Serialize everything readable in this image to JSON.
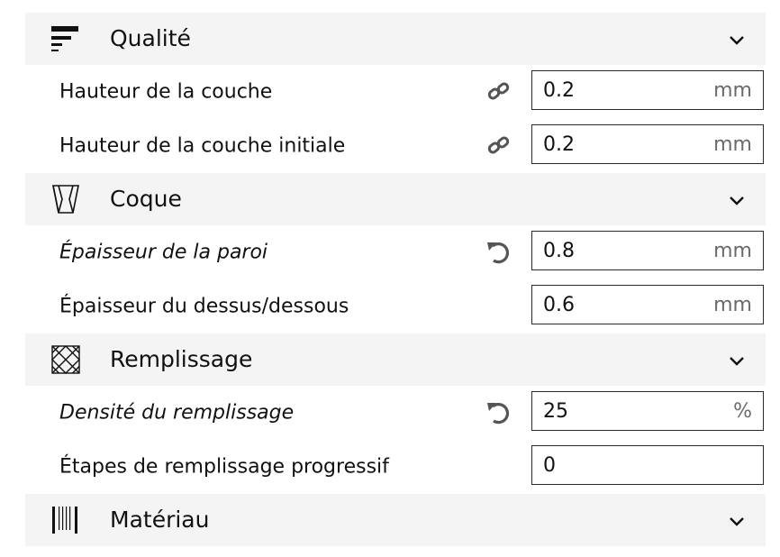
{
  "sections": {
    "quality": {
      "title": "Qualité",
      "icon": "quality-lines-icon",
      "rows": [
        {
          "label": "Hauteur de la couche",
          "value": "0.2",
          "unit": "mm",
          "icon": "link-icon"
        },
        {
          "label": "Hauteur de la couche initiale",
          "value": "0.2",
          "unit": "mm",
          "icon": "link-icon"
        }
      ]
    },
    "shell": {
      "title": "Coque",
      "icon": "shell-icon",
      "rows": [
        {
          "label": "Épaisseur de la paroi",
          "value": "0.8",
          "unit": "mm",
          "icon": "reset-icon",
          "italic": true
        },
        {
          "label": "Épaisseur du dessus/dessous",
          "value": "0.6",
          "unit": "mm"
        }
      ]
    },
    "infill": {
      "title": "Remplissage",
      "icon": "infill-pattern-icon",
      "rows": [
        {
          "label": "Densité du remplissage",
          "value": "25",
          "unit": "%",
          "icon": "reset-icon",
          "italic": true
        },
        {
          "label": "Étapes de remplissage progressif",
          "value": "0",
          "unit": ""
        }
      ]
    },
    "material": {
      "title": "Matériau",
      "icon": "material-bars-icon"
    }
  },
  "colors": {
    "header_bg": "#f4f4f4",
    "border": "#2b2b2b",
    "unit_text": "#6a6a6a"
  }
}
